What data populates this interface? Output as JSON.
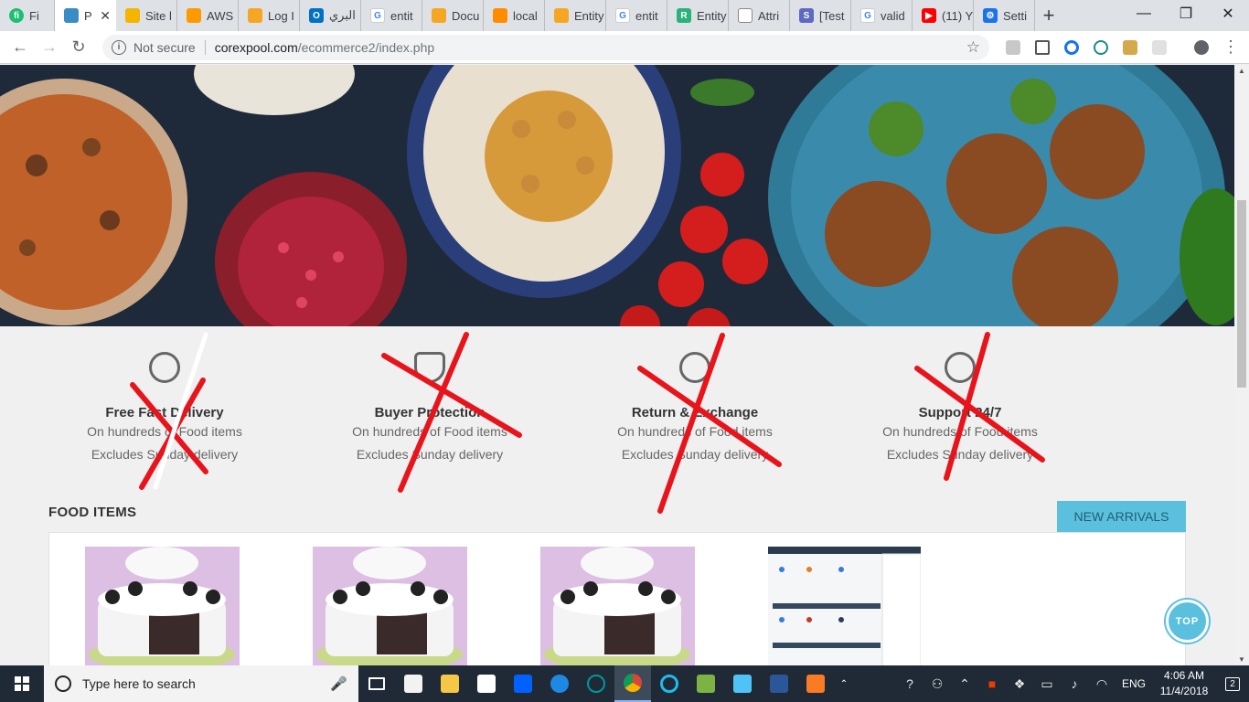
{
  "browser": {
    "tabs": [
      {
        "title": "Fi",
        "icon": "fiverr-icon",
        "color": "#1dbf73"
      },
      {
        "title": "P",
        "icon": "site-icon",
        "color": "#3b8bc4",
        "active": true
      },
      {
        "title": "Site l",
        "icon": "box-icon",
        "color": "#f4b400"
      },
      {
        "title": "AWS",
        "icon": "aws-icon",
        "color": "#ff9900"
      },
      {
        "title": "Log I",
        "icon": "grid-icon",
        "color": "#f5a623"
      },
      {
        "title": "البري",
        "icon": "outlook-icon",
        "color": "#0072c6"
      },
      {
        "title": "entit",
        "icon": "google-icon",
        "color": "#4285f4"
      },
      {
        "title": "Docu",
        "icon": "grid-icon",
        "color": "#f5a623"
      },
      {
        "title": "local",
        "icon": "pma-icon",
        "color": "#ff8c00"
      },
      {
        "title": "Entity",
        "icon": "grid-icon",
        "color": "#f5a623"
      },
      {
        "title": "entit",
        "icon": "google-icon",
        "color": "#4285f4"
      },
      {
        "title": "Entity",
        "icon": "r-icon",
        "color": "#2ab27b"
      },
      {
        "title": "Attri",
        "icon": "doc-icon",
        "color": "#888888"
      },
      {
        "title": "[Test",
        "icon": "s-icon",
        "color": "#5c6bc0"
      },
      {
        "title": "valid",
        "icon": "google-icon",
        "color": "#4285f4"
      },
      {
        "title": "(11) Y",
        "icon": "youtube-icon",
        "color": "#ff0000"
      },
      {
        "title": "Setti",
        "icon": "gear-icon",
        "color": "#1a73e8"
      }
    ],
    "close_label": "✕",
    "newtab_label": "+",
    "window": {
      "minimize": "—",
      "maximize": "❐",
      "close": "✕"
    },
    "nav": {
      "back": "←",
      "forward": "→",
      "reload": "↻"
    },
    "address": {
      "security": "Not secure",
      "host": "corexpool.com",
      "path": "/ecommerce2/index.php",
      "star": "☆"
    }
  },
  "page": {
    "features": [
      {
        "title": "Free Fast Delivery",
        "line1": "On hundreds of Food items",
        "line2": "Excludes Sunday delivery"
      },
      {
        "title": "Buyer Protection",
        "line1": "On hundreds of Food items",
        "line2": "Excludes Sunday delivery"
      },
      {
        "title": "Return & Exchange",
        "line1": "On hundreds of Food items",
        "line2": "Excludes Sunday delivery"
      },
      {
        "title": "Support 24/7",
        "line1": "On hundreds of Food items",
        "line2": "Excludes Sunday delivery"
      }
    ],
    "section_title": "FOOD ITEMS",
    "new_arrivals": "NEW ARRIVALS",
    "top_button": "TOP",
    "colors": {
      "accent": "#5bc0de",
      "cross": "#e8141c"
    }
  },
  "taskbar": {
    "search_placeholder": "Type here to search",
    "mic": "🎤",
    "language": "ENG",
    "time": "4:06 AM",
    "date": "11/4/2018",
    "notifications": "2"
  }
}
